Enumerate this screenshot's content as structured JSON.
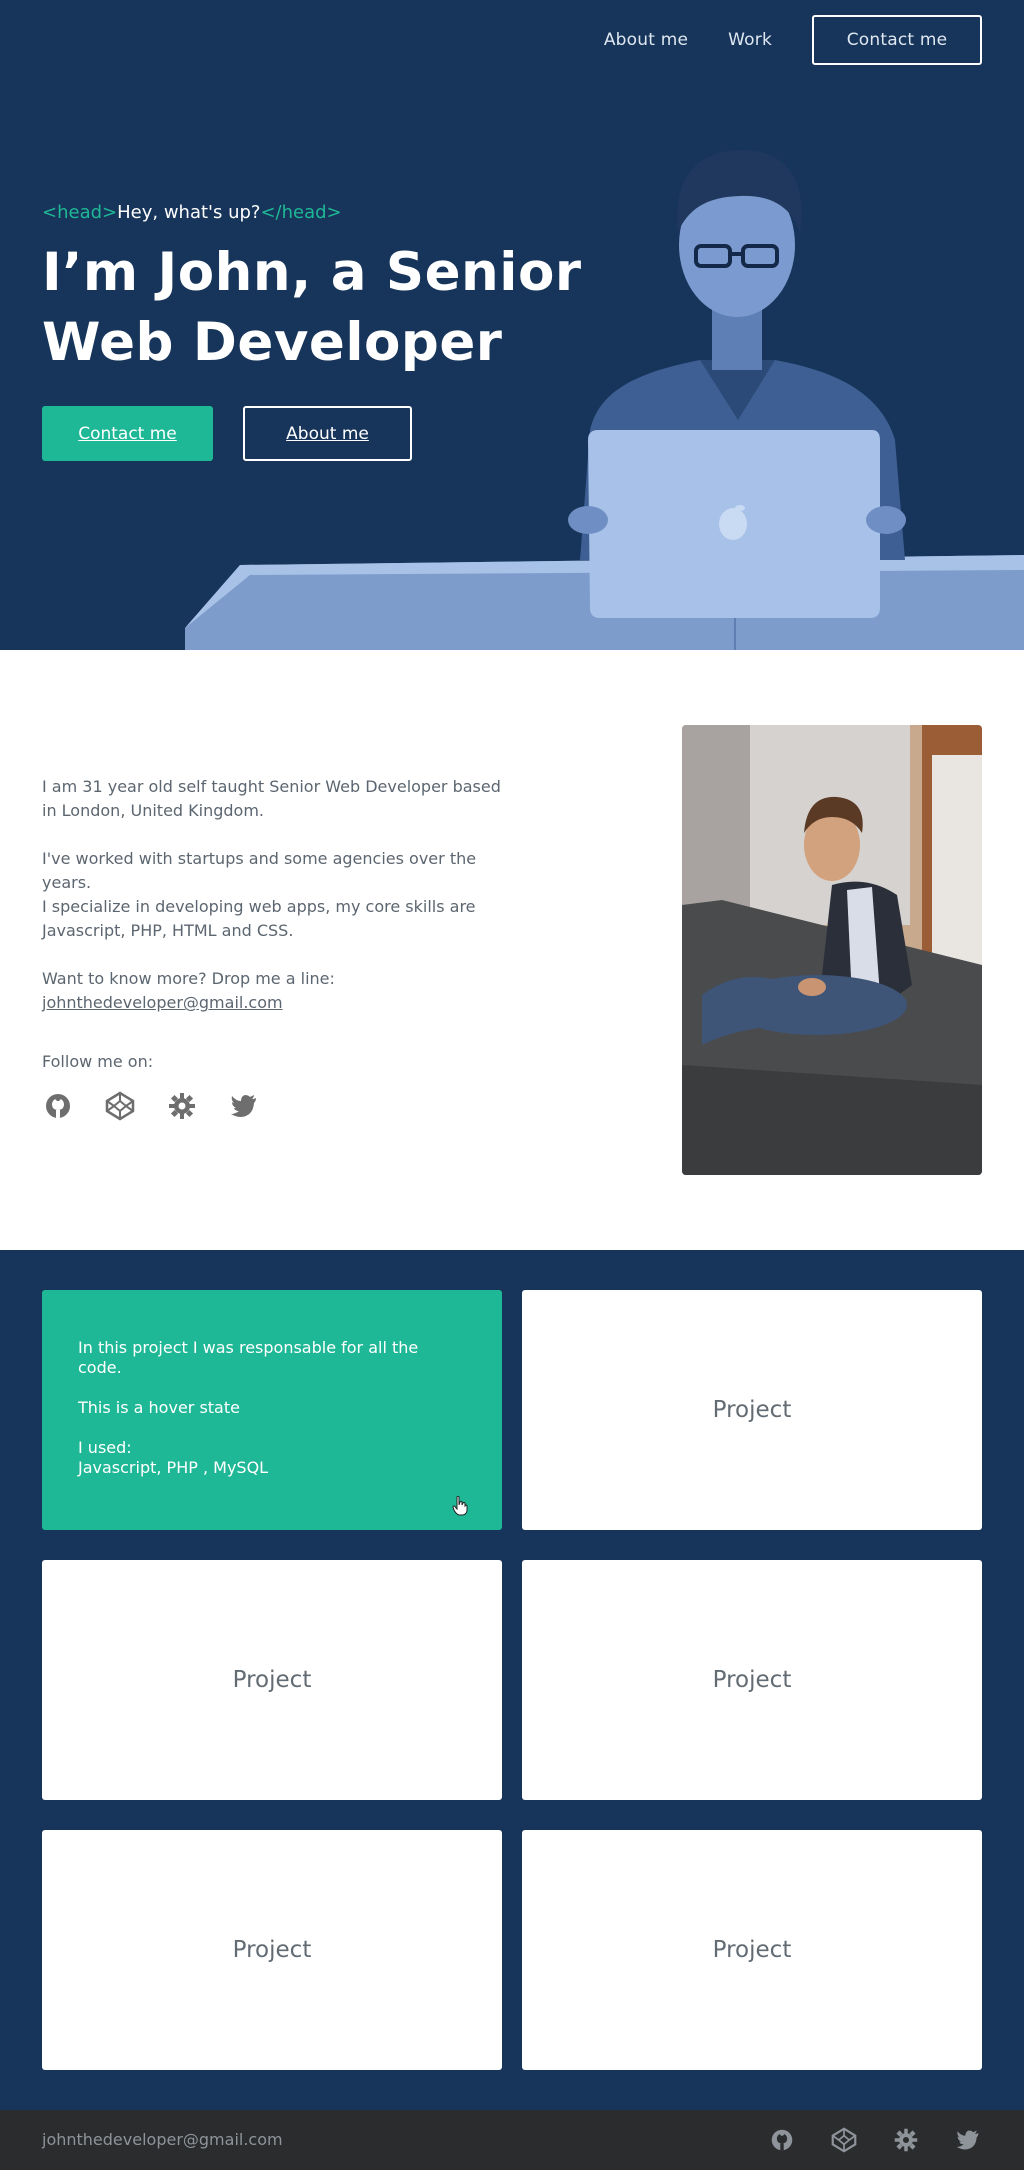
{
  "nav": {
    "about_label": "About me",
    "work_label": "Work",
    "contact_label": "Contact me"
  },
  "hero": {
    "tag_open": "<head>",
    "greeting": "Hey, what's up?",
    "tag_close": "</head>",
    "title": "I’m John, a Senior Web Developer",
    "contact_label": "Contact me",
    "about_label": "About me"
  },
  "about": {
    "para1": "I am 31 year old self taught Senior Web Developer based in London, United Kingdom.",
    "para2a": "I've worked with startups and some agencies over the years.",
    "para2b": "I specialize in developing web apps, my core skills are Javascript, PHP, HTML and CSS.",
    "para3": "Want to know more? Drop me a line:",
    "email": "johnthedeveloper@gmail.com",
    "follow_label": "Follow me on:",
    "social_icons": [
      "github-icon",
      "codepen-icon",
      "gear-icon",
      "twitter-icon"
    ]
  },
  "projects": {
    "hover_line1": "In this project I was responsable for all the code.",
    "hover_line2": "This is a hover state",
    "hover_line3": "I used:",
    "hover_line4": "Javascript, PHP , MySQL",
    "items": [
      "Project",
      "Project",
      "Project",
      "Project",
      "Project"
    ]
  },
  "footer": {
    "email": "johnthedeveloper@gmail.com"
  },
  "colors": {
    "navy": "#17355a",
    "accent": "#1fb896",
    "footer": "#2a2c2e",
    "text_gray": "#5c6670"
  }
}
